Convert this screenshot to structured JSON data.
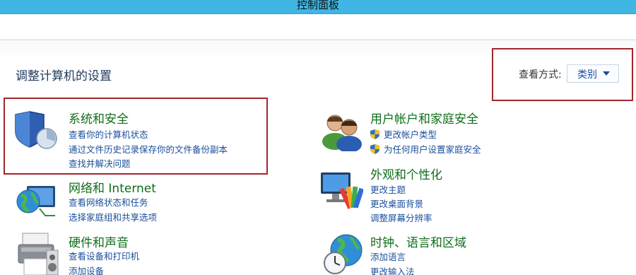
{
  "window": {
    "title": "控制面板"
  },
  "heading": "调整计算机的设置",
  "view_by": {
    "label": "查看方式:",
    "selected": "类别"
  },
  "categories": {
    "system_security": {
      "title": "系统和安全",
      "links": [
        "查看你的计算机状态",
        "通过文件历史记录保存你的文件备份副本",
        "查找并解决问题"
      ]
    },
    "network": {
      "title": "网络和 Internet",
      "links": [
        "查看网络状态和任务",
        "选择家庭组和共享选项"
      ]
    },
    "hardware": {
      "title": "硬件和声音",
      "links": [
        "查看设备和打印机",
        "添加设备"
      ]
    },
    "user_accounts": {
      "title": "用户帐户和家庭安全",
      "links": [
        "更改帐户类型",
        "为任何用户设置家庭安全"
      ]
    },
    "appearance": {
      "title": "外观和个性化",
      "links": [
        "更改主题",
        "更改桌面背景",
        "调整屏幕分辨率"
      ]
    },
    "clock_region": {
      "title": "时钟、语言和区域",
      "links": [
        "添加语言",
        "更改输入法"
      ]
    }
  },
  "colors": {
    "title_bar": "#3fb6e3",
    "category_title": "#0f6e1a",
    "link": "#1a4f9c",
    "highlight_border": "#a0272d"
  },
  "icons": [
    "shield-icon",
    "users-icon",
    "network-globe-icon",
    "appearance-monitor-icon",
    "printer-icon",
    "clock-globe-icon",
    "uac-shield-icon"
  ]
}
